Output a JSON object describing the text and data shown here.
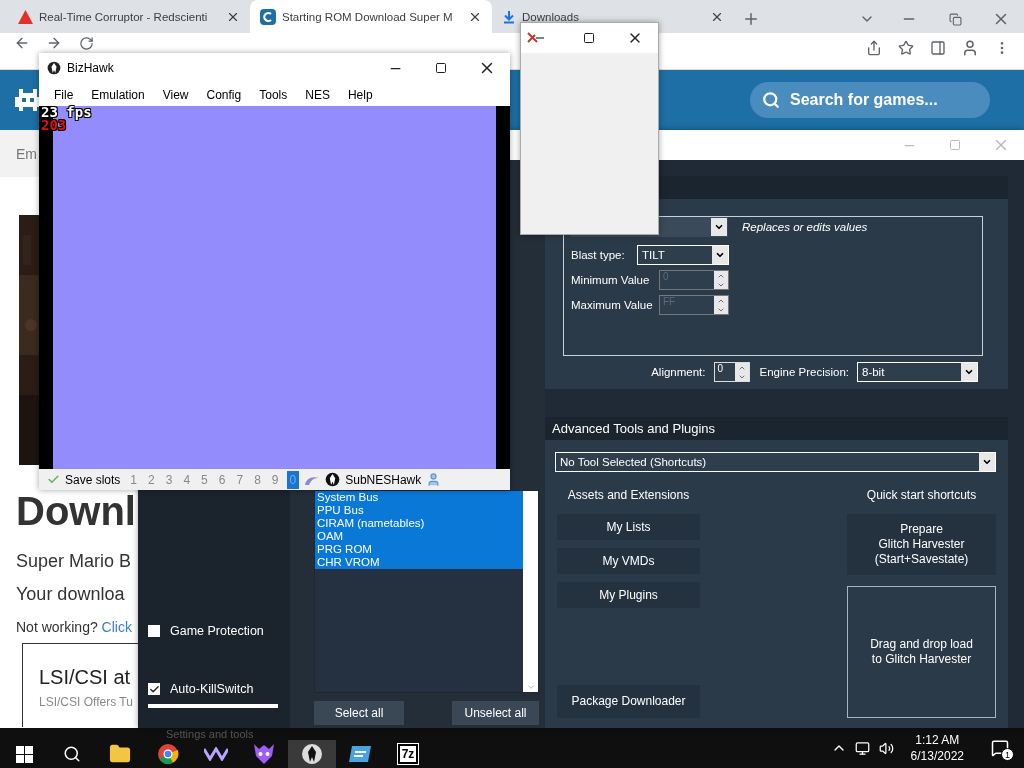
{
  "browser": {
    "tabs": [
      {
        "title": "Real-Time Corruptor - Redscienti",
        "kind": "warning",
        "selected": false
      },
      {
        "title": "Starting ROM Download Super M",
        "kind": "site",
        "selected": true
      },
      {
        "title": "Downloads",
        "kind": "download",
        "selected": false
      }
    ],
    "search": {
      "placeholder": "Search for games..."
    }
  },
  "website": {
    "breadcrumb": "Em",
    "heading": "Downl",
    "subtitle": "Super Mario B",
    "status": "Your downloa",
    "help": {
      "text": "Not working?",
      "link": "Click"
    },
    "ad": {
      "title": "LSI/CSI at",
      "text": "LSI/CSI Offers Tu"
    }
  },
  "bizhawk": {
    "title": "BizHawk",
    "menu": [
      "File",
      "Emulation",
      "View",
      "Config",
      "Tools",
      "NES",
      "Help"
    ],
    "fps": "23 fps",
    "frame": "203",
    "status": {
      "label": "Save slots",
      "slots": [
        {
          "label": "1",
          "selected": false
        },
        {
          "label": "2",
          "selected": false
        },
        {
          "label": "3",
          "selected": false
        },
        {
          "label": "4",
          "selected": false
        },
        {
          "label": "5",
          "selected": false
        },
        {
          "label": "6",
          "selected": false
        },
        {
          "label": "7",
          "selected": false
        },
        {
          "label": "8",
          "selected": false
        },
        {
          "label": "9",
          "selected": false
        },
        {
          "label": "0",
          "selected": true
        }
      ],
      "core": "SubNESHawk"
    }
  },
  "rtc": {
    "options": [
      {
        "label": "Game Protection",
        "checked": false
      },
      {
        "label": "Auto-KillSwitch",
        "checked": true
      }
    ],
    "footer": "Settings and tools",
    "domains": {
      "items": [
        {
          "label": "System Bus",
          "selected": true
        },
        {
          "label": "PPU Bus",
          "selected": true
        },
        {
          "label": "CIRAM (nametables)",
          "selected": true
        },
        {
          "label": "OAM",
          "selected": true
        },
        {
          "label": "PRG ROM",
          "selected": true
        },
        {
          "label": "CHR VROM",
          "selected": true
        }
      ],
      "buttons": [
        "Select all",
        "Unselect all"
      ]
    },
    "engine": {
      "description": "Replaces or edits values",
      "blast_type": {
        "label": "Blast type:",
        "value": "TILT"
      },
      "min": {
        "label": "Minimum Value",
        "value": "0",
        "disabled": true
      },
      "max": {
        "label": "Maximum Value",
        "value": "FF",
        "disabled": true
      },
      "alignment": {
        "label": "Alignment:",
        "value": "0"
      },
      "precision": {
        "label": "Engine Precision:",
        "value": "8-bit"
      }
    },
    "advanced": {
      "title": "Advanced Tools and Plugins",
      "tool": "No Tool Selected (Shortcuts)",
      "assets_title": "Assets and Extensions",
      "assets": [
        "My Lists",
        "My VMDs",
        "My Plugins"
      ],
      "downloader": "Package Downloader",
      "quick_title": "Quick start shortcuts",
      "prepare": "Prepare\nGlitch Harvester\n(Start+Savestate)",
      "drop": "Drag and drop load\nto Glitch Harvester"
    }
  },
  "taskbar": {
    "apps": [
      {
        "kind": "folder",
        "selected": false
      },
      {
        "kind": "chrome",
        "selected": false
      },
      {
        "kind": "wave",
        "selected": false
      },
      {
        "kind": "skull",
        "selected": false
      },
      {
        "kind": "hawk",
        "selected": true
      },
      {
        "kind": "window",
        "selected": false
      },
      {
        "kind": "archive",
        "label": "7z",
        "selected": false
      }
    ],
    "time": "1:12 AM",
    "date": "6/13/2022",
    "notifications": "1"
  }
}
